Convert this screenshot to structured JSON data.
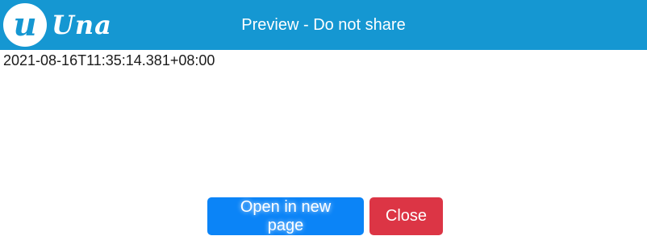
{
  "header": {
    "logo_letter": "u",
    "logo_text": "Una",
    "title": "Preview - Do not share",
    "background_color": "#1597d2"
  },
  "content": {
    "timestamp": "2021-08-16T11:35:14.381+08:00"
  },
  "actions": {
    "open_label": "Open in new page",
    "close_label": "Close",
    "open_color": "#0b84f7",
    "close_color": "#dc3545"
  }
}
